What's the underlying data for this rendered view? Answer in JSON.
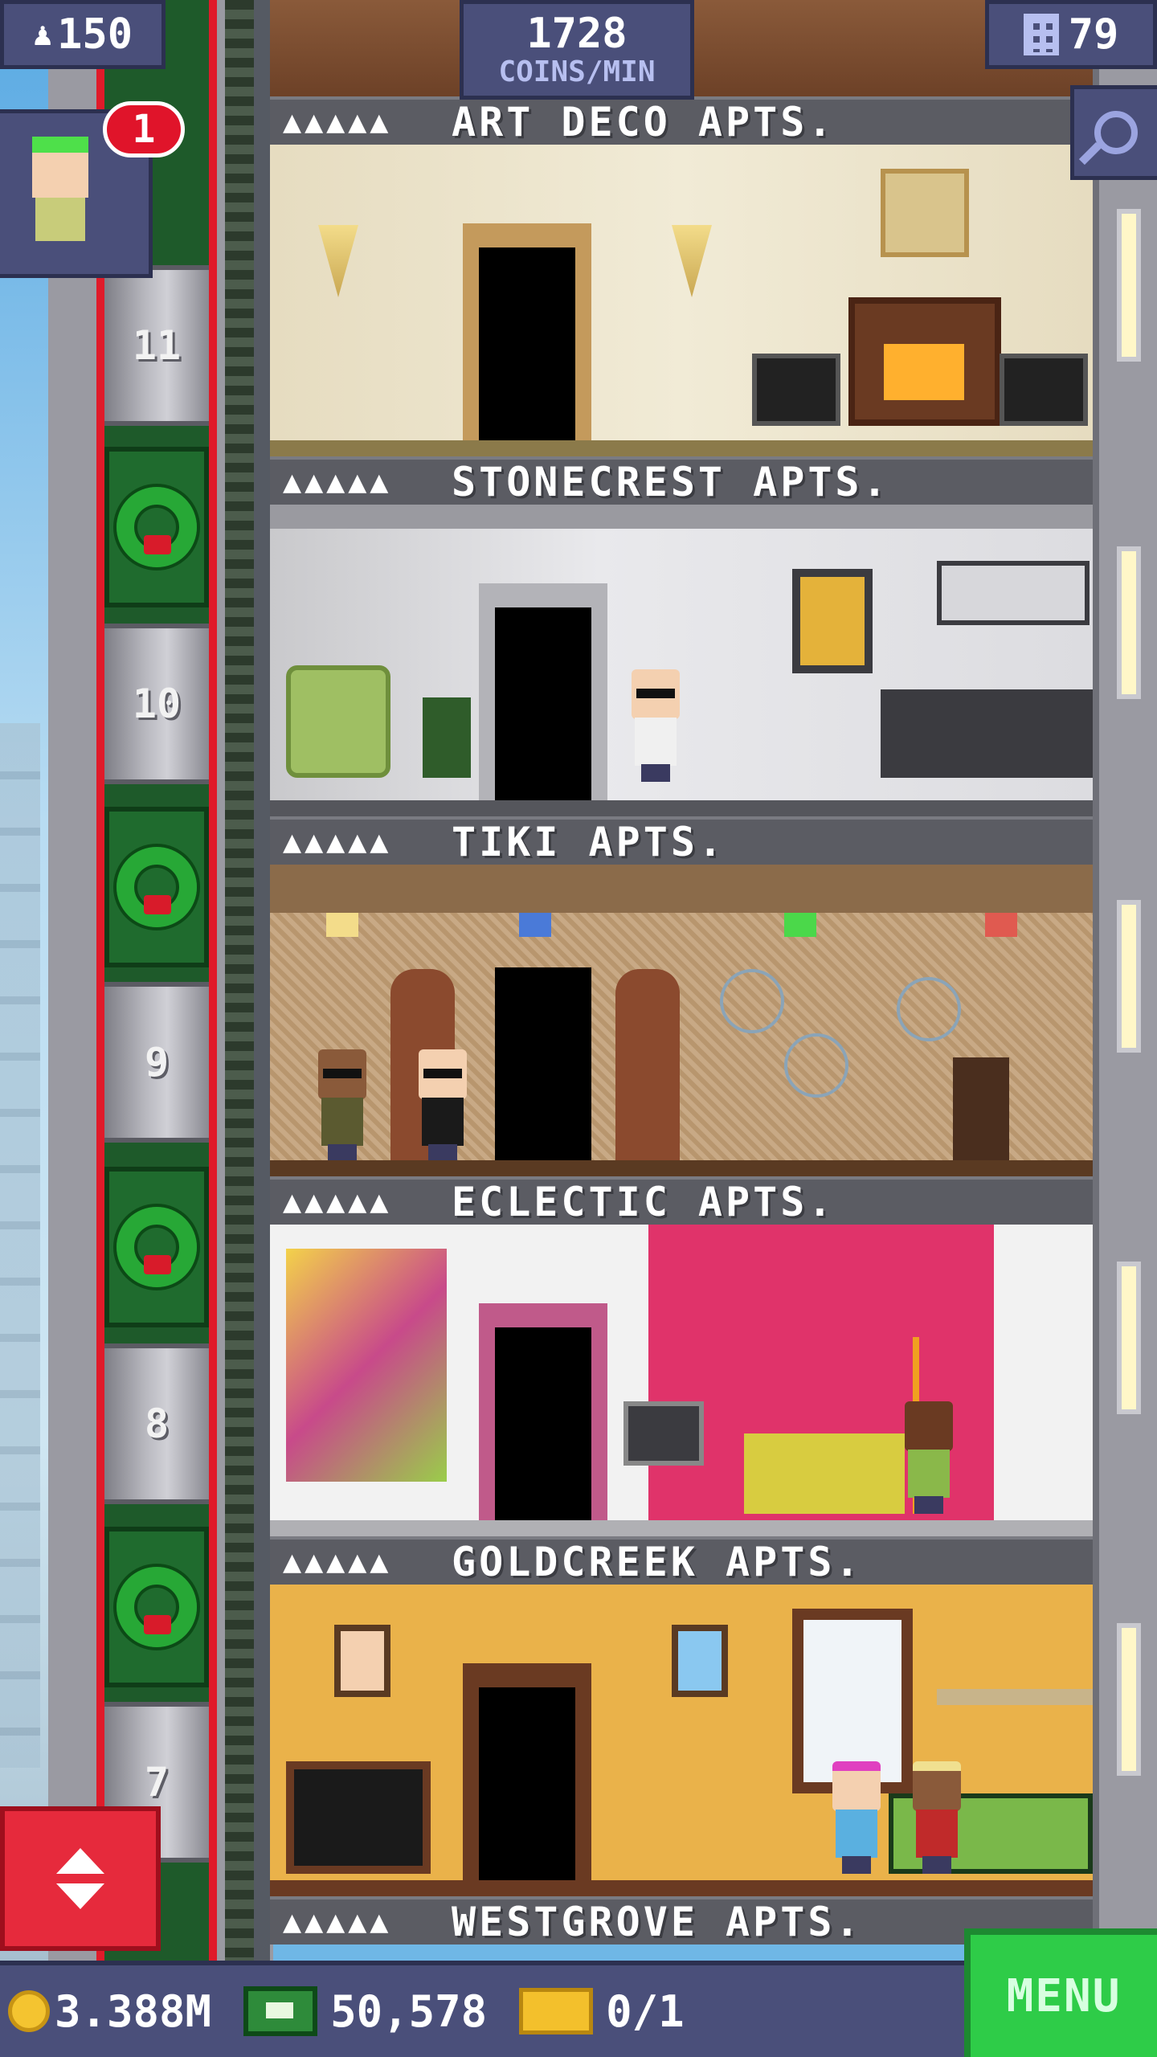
{
  "hud": {
    "population": "150",
    "coins_per_min": "1728",
    "coins_per_min_label": "COINS/MIN",
    "floor_count": "79",
    "notification_count": "1"
  },
  "elevator_shaft": {
    "floor_numbers": [
      "11",
      "10",
      "9",
      "8",
      "7"
    ]
  },
  "floors": [
    {
      "name": "ART DECO APTS.",
      "stars": "▲▲▲▲▲"
    },
    {
      "name": "STONECREST APTS.",
      "stars": "▲▲▲▲▲"
    },
    {
      "name": "TIKI APTS.",
      "stars": "▲▲▲▲▲"
    },
    {
      "name": "ECLECTIC APTS.",
      "stars": "▲▲▲▲▲"
    },
    {
      "name": "GOLDCREEK APTS.",
      "stars": "▲▲▲▲▲"
    },
    {
      "name": "WESTGROVE APTS.",
      "stars": "▲▲▲▲▲"
    }
  ],
  "bottom_bar": {
    "coins": "3.388M",
    "tower_bux": "50,578",
    "tickets": "0/1",
    "menu_label": "MENU"
  },
  "icons": {
    "population": "person-icon",
    "floors": "building-icon",
    "zoom": "magnifier-icon",
    "elevator": "up-down-arrows-icon",
    "coins": "coin-icon",
    "bux": "tower-bux-icon",
    "tickets": "ticket-icon"
  },
  "colors": {
    "hud_bg": "#4a4f7a",
    "menu_green": "#2ecc48",
    "elevator_red": "#e62a3c",
    "coin_gold": "#f4c430",
    "badge_red": "#e0142a"
  }
}
